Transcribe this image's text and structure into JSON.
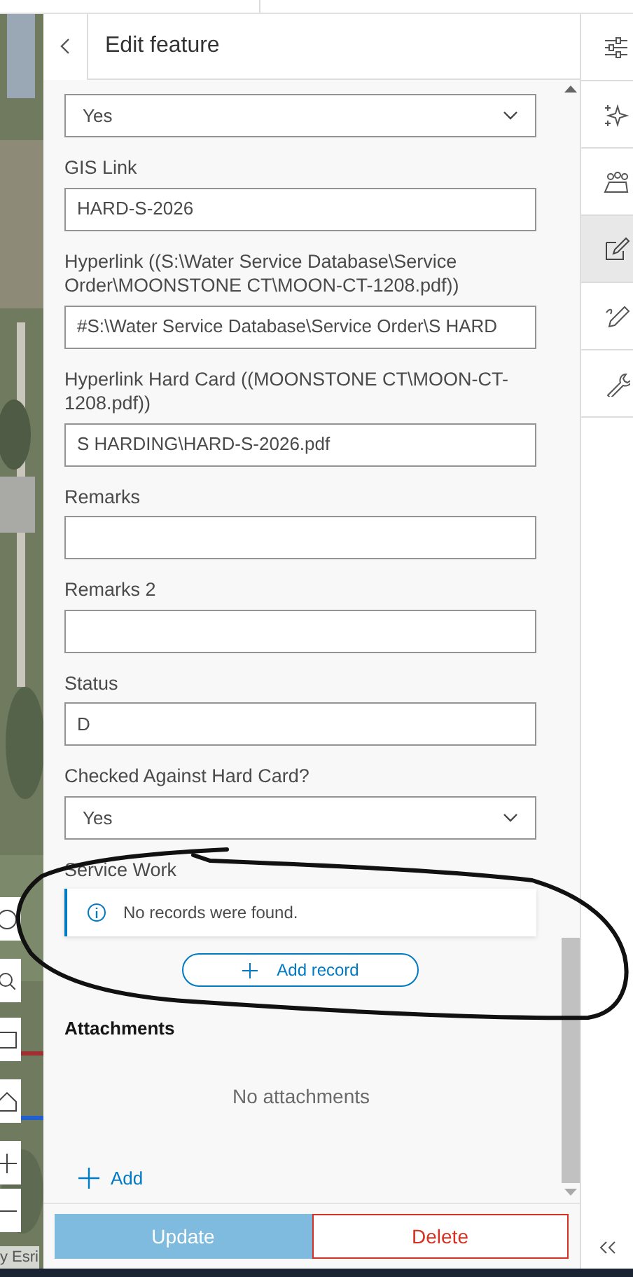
{
  "panel": {
    "title": "Edit feature"
  },
  "fields": [
    {
      "kind": "select",
      "value": "Yes"
    },
    {
      "kind": "input",
      "label": "GIS Link",
      "value": "HARD-S-2026"
    },
    {
      "kind": "input",
      "label": "Hyperlink ((S:\\Water Service Database\\Service Order\\MOONSTONE CT\\MOON-CT-1208.pdf))",
      "value": "#S:\\Water Service Database\\Service Order\\S HARD"
    },
    {
      "kind": "input",
      "label": "Hyperlink Hard Card ((MOONSTONE CT\\MOON-CT-1208.pdf))",
      "value": "S HARDING\\HARD-S-2026.pdf"
    },
    {
      "kind": "input",
      "label": "Remarks"
    },
    {
      "kind": "input",
      "label": "Remarks 2"
    },
    {
      "kind": "input",
      "label": "Status",
      "value": "D"
    },
    {
      "kind": "select",
      "label": "Checked Against Hard Card?",
      "value": "Yes"
    }
  ],
  "related": {
    "title": "Service Work",
    "notice": "No records were found.",
    "button": "Add record"
  },
  "attachments": {
    "title": "Attachments",
    "empty": "No attachments",
    "add": "Add"
  },
  "footer": {
    "primary": {
      "label": "Update",
      "disabled": true
    },
    "secondary": "Delete"
  },
  "rail": [
    {
      "selected": false
    },
    {
      "selected": false
    },
    {
      "selected": false
    },
    {
      "selected": true
    },
    {
      "selected": false
    },
    {
      "selected": false
    }
  ],
  "map": {
    "attribution": "y Esri"
  }
}
